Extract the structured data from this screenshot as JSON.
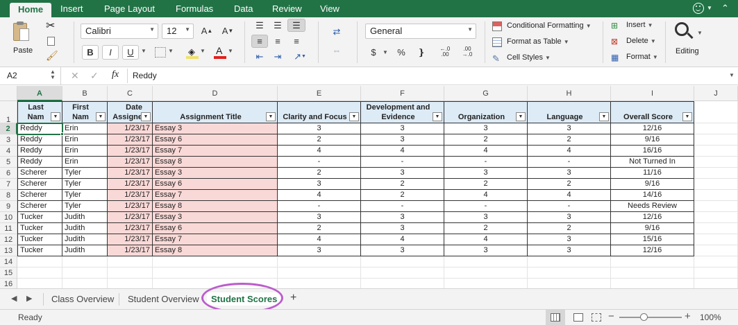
{
  "ribbon_tabs": [
    "Home",
    "Insert",
    "Page Layout",
    "Formulas",
    "Data",
    "Review",
    "View"
  ],
  "clipboard": {
    "paste_label": "Paste"
  },
  "font": {
    "name": "Calibri",
    "size": "12",
    "bold": "B",
    "italic": "I",
    "underline": "U"
  },
  "number": {
    "format": "General"
  },
  "styles": {
    "conditional": "Conditional Formatting",
    "format_table": "Format as Table",
    "cell_styles": "Cell Styles"
  },
  "cells_group": {
    "insert": "Insert",
    "delete": "Delete",
    "format": "Format"
  },
  "editing": {
    "label": "Editing"
  },
  "formula_bar": {
    "name_box": "A2",
    "fx": "fx",
    "content": "Reddy"
  },
  "columns": [
    "A",
    "B",
    "C",
    "D",
    "E",
    "F",
    "G",
    "H",
    "I",
    "J"
  ],
  "rows": [
    "1",
    "2",
    "3",
    "4",
    "5",
    "6",
    "7",
    "8",
    "9",
    "10",
    "11",
    "12",
    "13",
    "14",
    "15",
    "16"
  ],
  "headers": {
    "a": "Last Nam",
    "b": "First Nam",
    "c1": "Date",
    "c2": "Assigne",
    "d": "Assignment Title",
    "e": "Clarity and Focus",
    "f1": "Development and",
    "f2": "Evidence",
    "g": "Organization",
    "h": "Language",
    "i": "Overall Score"
  },
  "table": [
    [
      "Reddy",
      "Erin",
      "1/23/17",
      "Essay 3",
      "3",
      "3",
      "3",
      "3",
      "12/16"
    ],
    [
      "Reddy",
      "Erin",
      "1/23/17",
      "Essay 6",
      "2",
      "3",
      "2",
      "2",
      "9/16"
    ],
    [
      "Reddy",
      "Erin",
      "1/23/17",
      "Essay 7",
      "4",
      "4",
      "4",
      "4",
      "16/16"
    ],
    [
      "Reddy",
      "Erin",
      "1/23/17",
      "Essay 8",
      "-",
      "-",
      "-",
      "-",
      "Not Turned In"
    ],
    [
      "Scherer",
      "Tyler",
      "1/23/17",
      "Essay 3",
      "2",
      "3",
      "3",
      "3",
      "11/16"
    ],
    [
      "Scherer",
      "Tyler",
      "1/23/17",
      "Essay 6",
      "3",
      "2",
      "2",
      "2",
      "9/16"
    ],
    [
      "Scherer",
      "Tyler",
      "1/23/17",
      "Essay 7",
      "4",
      "2",
      "4",
      "4",
      "14/16"
    ],
    [
      "Scherer",
      "Tyler",
      "1/23/17",
      "Essay 8",
      "-",
      "-",
      "-",
      "-",
      "Needs Review"
    ],
    [
      "Tucker",
      "Judith",
      "1/23/17",
      "Essay 3",
      "3",
      "3",
      "3",
      "3",
      "12/16"
    ],
    [
      "Tucker",
      "Judith",
      "1/23/17",
      "Essay 6",
      "2",
      "3",
      "2",
      "2",
      "9/16"
    ],
    [
      "Tucker",
      "Judith",
      "1/23/17",
      "Essay 7",
      "4",
      "4",
      "4",
      "3",
      "15/16"
    ],
    [
      "Tucker",
      "Judith",
      "1/23/17",
      "Essay 8",
      "3",
      "3",
      "3",
      "3",
      "12/16"
    ]
  ],
  "sheet_tabs": [
    "Class Overview",
    "Student Overview",
    "Student Scores"
  ],
  "add_sheet": "+",
  "status": {
    "ready": "Ready",
    "zoom": "100%",
    "minus": "−",
    "plus": "+"
  },
  "colors": {
    "accent": "#217346",
    "header_fill": "#ddebf6",
    "pink_fill": "#f9d9d7",
    "highlight_oval": "#bb5dcc"
  }
}
